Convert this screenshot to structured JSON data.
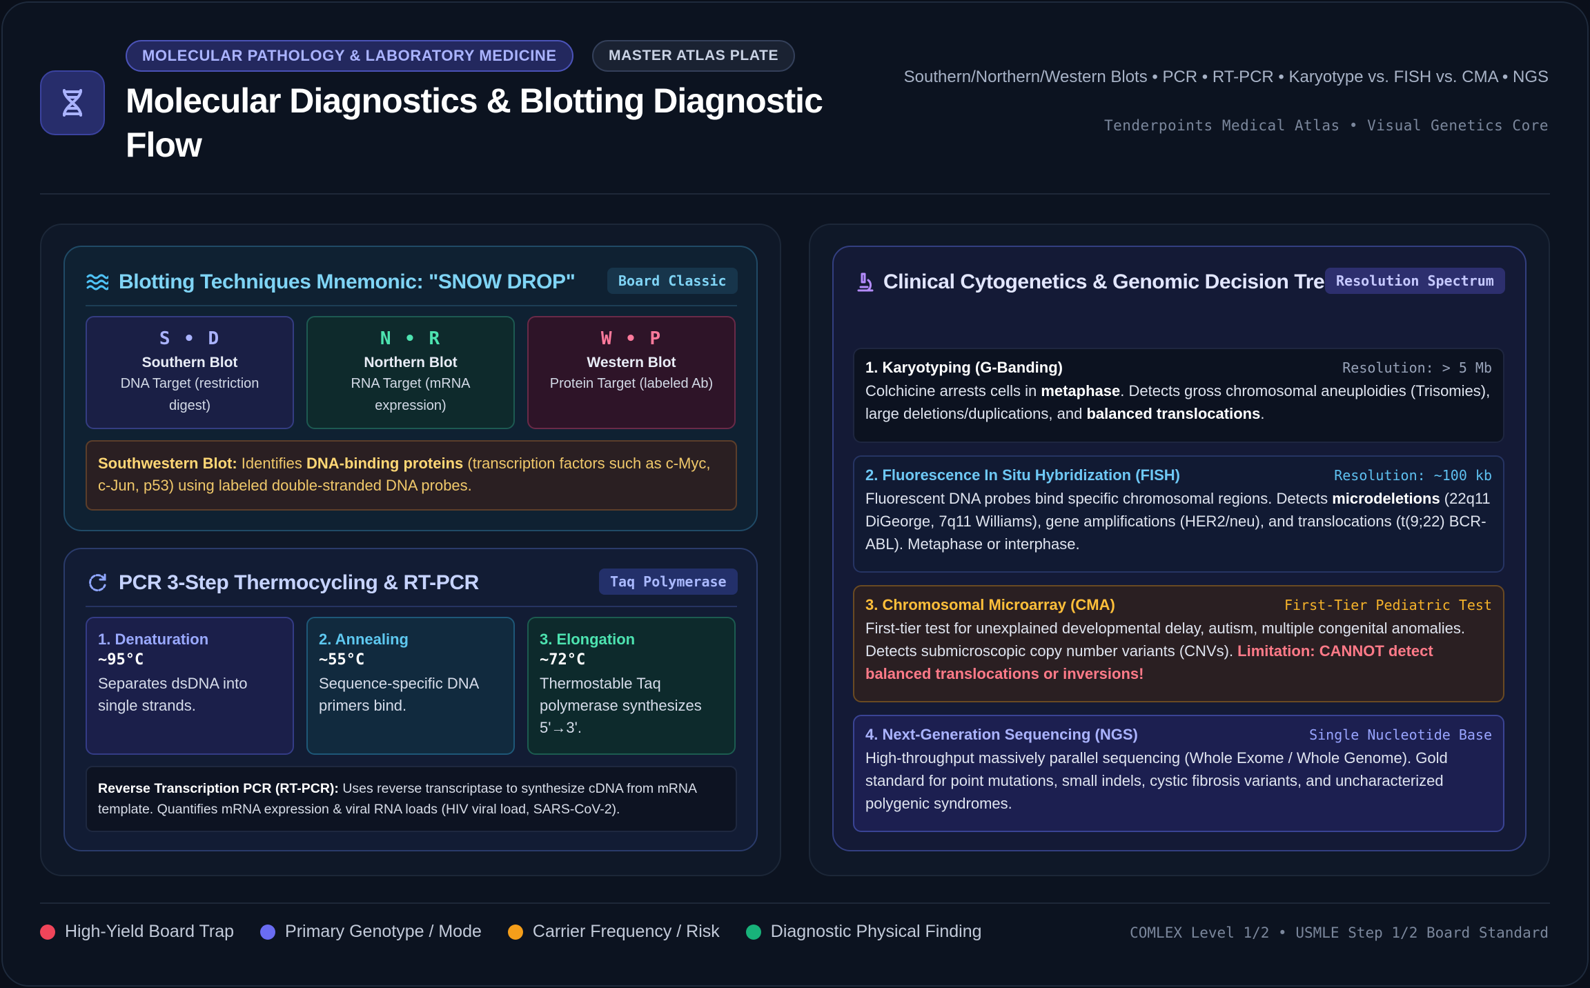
{
  "header": {
    "pill_category": "MOLECULAR PATHOLOGY & LABORATORY MEDICINE",
    "pill_plate": "MASTER ATLAS PLATE",
    "title": "Molecular Diagnostics & Blotting Diagnostic Flow",
    "subtitle": "Southern/Northern/Western Blots • PCR • RT-PCR • Karyotype vs. FISH vs. CMA • NGS",
    "meta": "Tenderpoints Medical Atlas • Visual Genetics Core",
    "logo_icon": "dna-icon"
  },
  "blotting": {
    "title": "Blotting Techniques Mnemonic: \"SNOW DROP\"",
    "tag": "Board Classic",
    "cards": [
      {
        "letters": "S • D",
        "name": "Southern Blot",
        "desc": "DNA Target (restriction digest)"
      },
      {
        "letters": "N • R",
        "name": "Northern Blot",
        "desc": "RNA Target (mRNA expression)"
      },
      {
        "letters": "W • P",
        "name": "Western Blot",
        "desc": "Protein Target (labeled Ab)"
      }
    ],
    "southwestern": {
      "label": "Southwestern Blot:",
      "pre": " Identifies ",
      "bold": "DNA-binding proteins",
      "post": " (transcription factors such as c-Myc, c-Jun, p53) using labeled double-stranded DNA probes."
    }
  },
  "pcr": {
    "title": "PCR 3-Step Thermocycling & RT-PCR",
    "tag": "Taq Polymerase",
    "steps": [
      {
        "name": "1. Denaturation",
        "temp": "~95°C",
        "desc": "Separates dsDNA into single strands."
      },
      {
        "name": "2. Annealing",
        "temp": "~55°C",
        "desc": "Sequence-specific DNA primers bind."
      },
      {
        "name": "3. Elongation",
        "temp": "~72°C",
        "desc": "Thermostable Taq polymerase synthesizes 5'→3'."
      }
    ],
    "rt": {
      "label": "Reverse Transcription PCR (RT-PCR):",
      "text": " Uses reverse transcriptase to synthesize cDNA from mRNA template. Quantifies mRNA expression & viral RNA loads (HIV viral load, SARS-CoV-2)."
    }
  },
  "cyto": {
    "title": "Clinical Cytogenetics & Genomic Decision Tree",
    "tag": "Resolution Spectrum",
    "tests": [
      {
        "name": "1. Karyotyping (G-Banding)",
        "res": "Resolution: > 5 Mb",
        "p1": "Colchicine arrests cells in ",
        "b1": "metaphase",
        "p2": ". Detects gross chromosomal aneuploidies (Trisomies), large deletions/duplications, and ",
        "b2": "balanced translocations",
        "p3": "."
      },
      {
        "name": "2. Fluorescence In Situ Hybridization (FISH)",
        "res": "Resolution: ~100 kb",
        "p1": "Fluorescent DNA probes bind specific chromosomal regions. Detects ",
        "b1": "microdeletions",
        "p2": " (22q11 DiGeorge, 7q11 Williams), gene amplifications (HER2/neu), and translocations (t(9;22) BCR-ABL). Metaphase or interphase."
      },
      {
        "name": "3. Chromosomal Microarray (CMA)",
        "res": "First-Tier Pediatric Test",
        "p1": "First-tier test for unexplained developmental delay, autism, multiple congenital anomalies. Detects submicroscopic copy number variants (CNVs). ",
        "warn": "Limitation: CANNOT detect balanced translocations or inversions!"
      },
      {
        "name": "4. Next-Generation Sequencing (NGS)",
        "res": "Single Nucleotide Base",
        "p1": "High-throughput massively parallel sequencing (Whole Exome / Whole Genome). Gold standard for point mutations, small indels, cystic fibrosis variants, and uncharacterized polygenic syndromes."
      }
    ]
  },
  "legend": [
    {
      "label": "High-Yield Board Trap",
      "color": "#f0455a"
    },
    {
      "label": "Primary Genotype / Mode",
      "color": "#6a6cf2"
    },
    {
      "label": "Carrier Frequency / Risk",
      "color": "#f59e1a"
    },
    {
      "label": "Diagnostic Physical Finding",
      "color": "#18b27a"
    }
  ],
  "footer": "COMLEX Level 1/2 • USMLE Step 1/2 Board Standard"
}
